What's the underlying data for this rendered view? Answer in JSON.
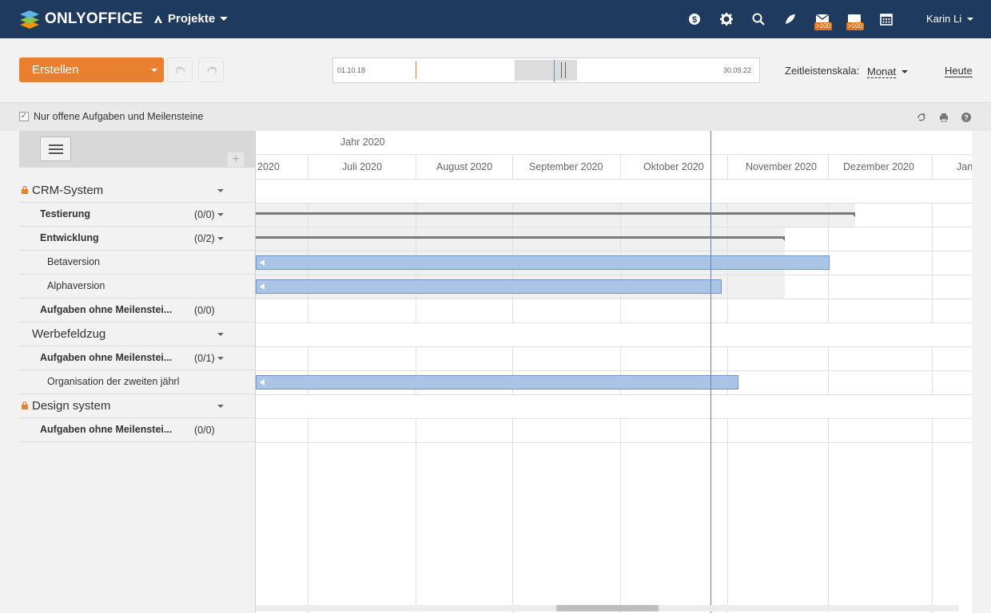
{
  "topbar": {
    "logo_text": "ONLYOFFICE",
    "module_label": "Projekte",
    "mail_badge": ">100",
    "chat_badge": ">100",
    "user_name": "Karin Li"
  },
  "toolbar": {
    "create_label": "Erstellen",
    "timeline_start": "01.10.18",
    "timeline_end": "30.09.22",
    "scale_label": "Zeitleistenskala:",
    "scale_value": "Monat",
    "today_label": "Heute"
  },
  "filter": {
    "label": "Nur offene Aufgaben und Meilensteine",
    "checked": true
  },
  "tree": {
    "rows": [
      {
        "type": "project",
        "name": "CRM-System",
        "locked": true
      },
      {
        "type": "milestone",
        "name": "Testierung",
        "count": "(0/0)"
      },
      {
        "type": "milestone",
        "name": "Entwicklung",
        "count": "(0/2)"
      },
      {
        "type": "task",
        "name": "Betaversion"
      },
      {
        "type": "task",
        "name": "Alphaversion"
      },
      {
        "type": "milestone",
        "name": "Aufgaben ohne Meilenstei...",
        "count": "(0/0)"
      },
      {
        "type": "project",
        "name": "Werbefeldzug",
        "locked": false
      },
      {
        "type": "milestone",
        "name": "Aufgaben ohne Meilenstei...",
        "count": "(0/1)"
      },
      {
        "type": "task",
        "name": "Organisation der zweiten jährl"
      },
      {
        "type": "project",
        "name": "Design system",
        "locked": true
      },
      {
        "type": "milestone",
        "name": "Aufgaben ohne Meilenstei...",
        "count": "(0/0)"
      }
    ]
  },
  "gantt": {
    "year_label": "Jahr 2020",
    "months": [
      "2020",
      "Juli 2020",
      "August 2020",
      "September 2020",
      "Oktober 2020",
      "November 2020",
      "Dezember 2020",
      "Jan"
    ]
  },
  "colors": {
    "topbar": "#1e3a5f",
    "accent": "#e8802f",
    "task_bar": "#a9c4e4",
    "today_line": "#5f84c9"
  }
}
